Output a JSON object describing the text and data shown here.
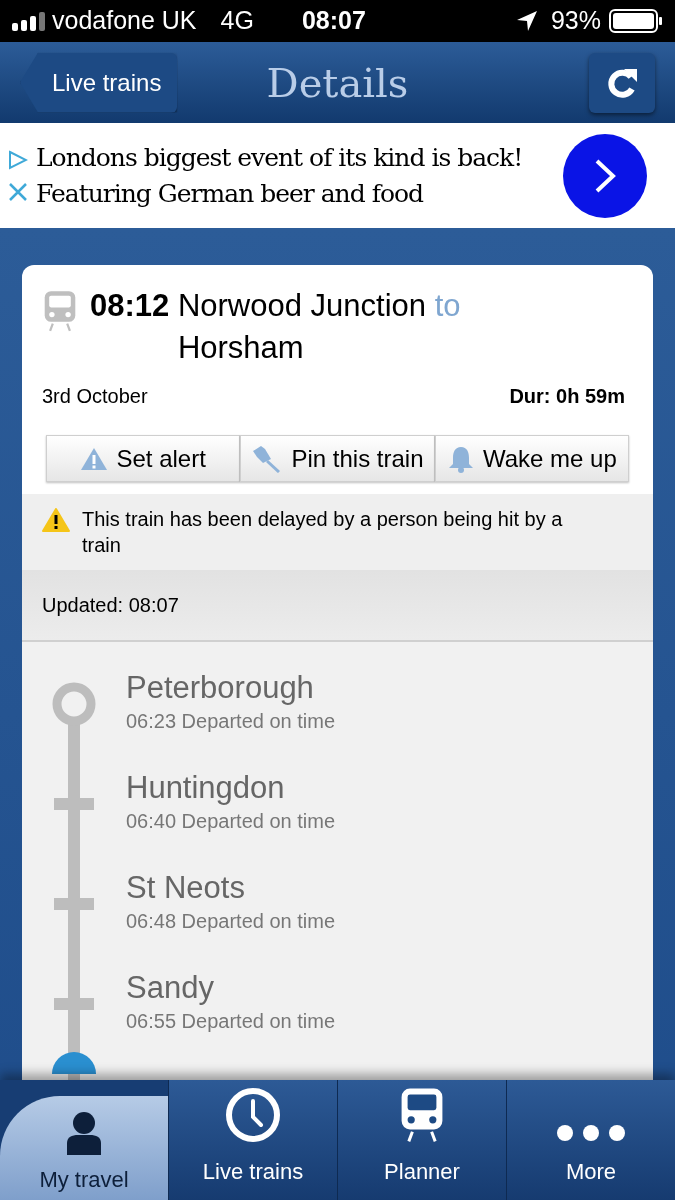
{
  "status_bar": {
    "carrier": "vodafone UK",
    "network": "4G",
    "time": "08:07",
    "battery": "93%"
  },
  "nav_bar": {
    "back": "Live trains",
    "title": "Details"
  },
  "ad": {
    "text": "Londons biggest event of its kind is back! Featuring German beer and food"
  },
  "train": {
    "time": "08:12",
    "from": "Norwood Junction",
    "to_word": "to",
    "to": "Horsham",
    "date": "3rd October",
    "duration": "Dur: 0h 59m"
  },
  "actions": [
    {
      "kind": "alert",
      "label": "Set alert"
    },
    {
      "kind": "pin",
      "label": "Pin this train"
    },
    {
      "kind": "bell",
      "label": "Wake me up"
    }
  ],
  "notice": "This train has been delayed by a person being hit by a train",
  "updated": "Updated: 08:07",
  "stations": [
    {
      "kind": "origin",
      "name": "Peterborough",
      "status": "06:23 Departed on time"
    },
    {
      "kind": "stop",
      "name": "Huntingdon",
      "status": "06:40 Departed on time"
    },
    {
      "kind": "stop",
      "name": "St Neots",
      "status": "06:48 Departed on time"
    },
    {
      "kind": "stop",
      "name": "Sandy",
      "status": "06:55 Departed on time"
    }
  ],
  "tabs": [
    {
      "kind": "person",
      "label": "My travel",
      "selected": true
    },
    {
      "kind": "clock",
      "label": "Live trains",
      "selected": false
    },
    {
      "kind": "train",
      "label": "Planner",
      "selected": false
    },
    {
      "kind": "more",
      "label": "More",
      "selected": false
    }
  ]
}
